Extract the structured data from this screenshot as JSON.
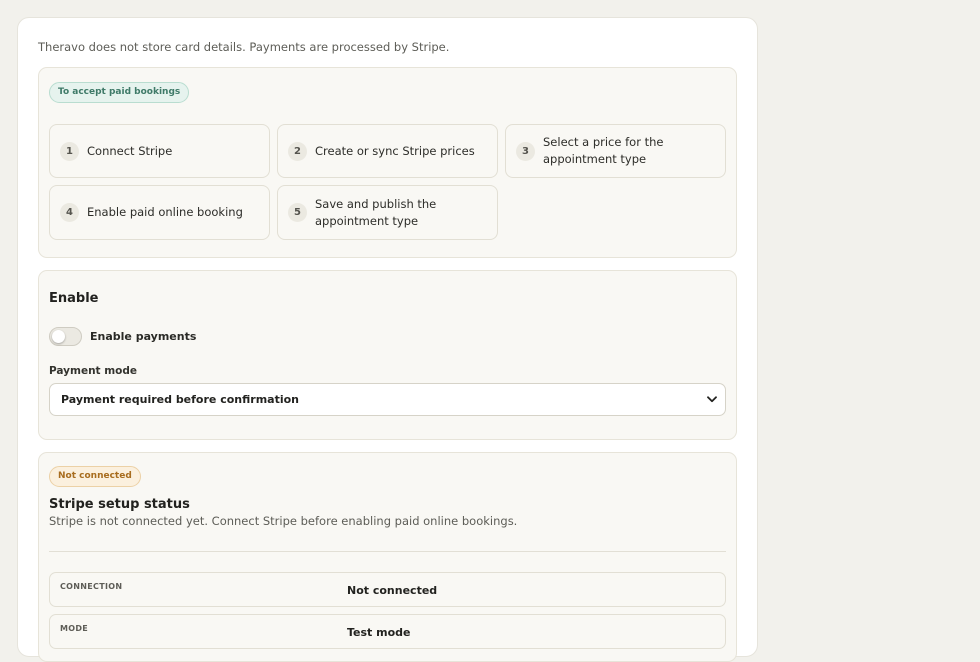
{
  "intro": "Theravo does not store card details. Payments are processed by Stripe.",
  "steps_section": {
    "badge": "To accept paid bookings",
    "steps": [
      {
        "num": "1",
        "label": "Connect Stripe"
      },
      {
        "num": "2",
        "label": "Create or sync Stripe prices"
      },
      {
        "num": "3",
        "label": "Select a price for the appointment type"
      },
      {
        "num": "4",
        "label": "Enable paid online booking"
      },
      {
        "num": "5",
        "label": "Save and publish the appointment type"
      }
    ]
  },
  "enable_section": {
    "heading": "Enable",
    "toggle_label": "Enable payments",
    "toggle_on": false,
    "payment_mode_label": "Payment mode",
    "payment_mode_value": "Payment required before confirmation"
  },
  "status_section": {
    "badge": "Not connected",
    "title": "Stripe setup status",
    "description": "Stripe is not connected yet. Connect Stripe before enabling paid online bookings.",
    "rows": [
      {
        "key": "Connection",
        "value": "Not connected"
      },
      {
        "key": "Mode",
        "value": "Test mode"
      }
    ]
  },
  "colors": {
    "teal_badge": "#3f7a68",
    "amber_badge": "#a86d1f",
    "page_bg": "#f2f1ec"
  },
  "icons": {
    "select_chevron": "chevron-down-icon"
  }
}
